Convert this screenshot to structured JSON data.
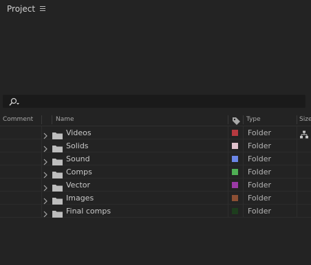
{
  "panel": {
    "title": "Project"
  },
  "search": {
    "placeholder": "",
    "value": ""
  },
  "columns": {
    "comment": "Comment",
    "name": "Name",
    "type": "Type",
    "size": "Size"
  },
  "colors": {
    "background": "#232323",
    "search_bg": "#1a1a1a"
  },
  "rows": [
    {
      "name": "Videos",
      "type": "Folder",
      "label_color": "#b63a40"
    },
    {
      "name": "Solids",
      "type": "Folder",
      "label_color": "#e0c2cc"
    },
    {
      "name": "Sound",
      "type": "Folder",
      "label_color": "#6b86e6"
    },
    {
      "name": "Comps",
      "type": "Folder",
      "label_color": "#4faf54"
    },
    {
      "name": "Vector",
      "type": "Folder",
      "label_color": "#9a3aa6"
    },
    {
      "name": "Images",
      "type": "Folder",
      "label_color": "#8c4f34"
    },
    {
      "name": "Final comps",
      "type": "Folder",
      "label_color": "#1d3d1d"
    }
  ],
  "icons": {
    "panel_menu": "hamburger-menu-icon",
    "search": "search-icon",
    "label": "label-tag-icon",
    "flowchart": "flowchart-icon",
    "expand": "chevron-right-icon",
    "folder": "folder-icon"
  }
}
